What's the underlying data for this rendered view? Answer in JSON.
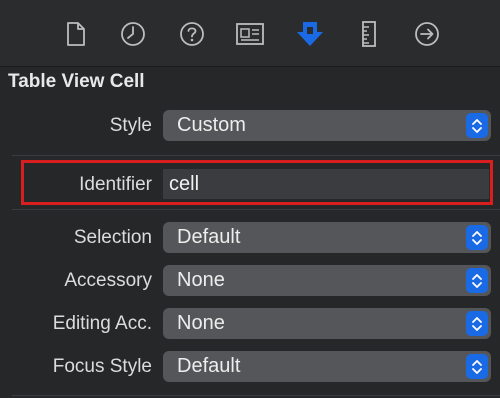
{
  "toolbar": {
    "icons": [
      "file-inspector-icon",
      "history-inspector-icon",
      "quick-help-icon",
      "identity-inspector-icon",
      "attributes-inspector-icon",
      "size-inspector-icon",
      "connections-inspector-icon"
    ],
    "active_color": "#1a6ae5",
    "inactive_color": "#bdbdbd"
  },
  "section": {
    "title": "Table View Cell"
  },
  "fields": {
    "style": {
      "label": "Style",
      "value": "Custom"
    },
    "identifier": {
      "label": "Identifier",
      "value": "cell",
      "highlight_color": "#d81e1e"
    },
    "selection": {
      "label": "Selection",
      "value": "Default"
    },
    "accessory": {
      "label": "Accessory",
      "value": "None"
    },
    "editing_accessory": {
      "label": "Editing Acc.",
      "value": "None"
    },
    "focus_style": {
      "label": "Focus Style",
      "value": "Default"
    }
  }
}
